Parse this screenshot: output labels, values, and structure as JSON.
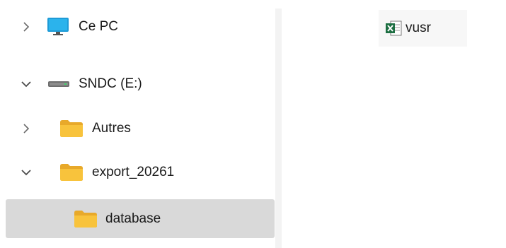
{
  "navigation": {
    "items": [
      {
        "label": "Ce PC",
        "icon": "monitor-icon",
        "chevron": "chevron-right-icon"
      },
      {
        "label": "SNDC (E:)",
        "icon": "drive-icon",
        "chevron": "chevron-down-icon"
      },
      {
        "label": "Autres",
        "icon": "folder-icon",
        "chevron": "chevron-right-icon"
      },
      {
        "label": "export_20261",
        "icon": "folder-icon",
        "chevron": "chevron-down-icon"
      },
      {
        "label": "database",
        "icon": "folder-icon",
        "chevron": "",
        "selected": true
      }
    ]
  },
  "content": {
    "files": [
      {
        "name": "vusr",
        "icon": "excel-file-icon"
      }
    ]
  },
  "colors": {
    "selection": "#d9d9d9",
    "folder": "#f8c33c",
    "monitor": "#1e9bd7",
    "excel": "#1d6f42"
  }
}
